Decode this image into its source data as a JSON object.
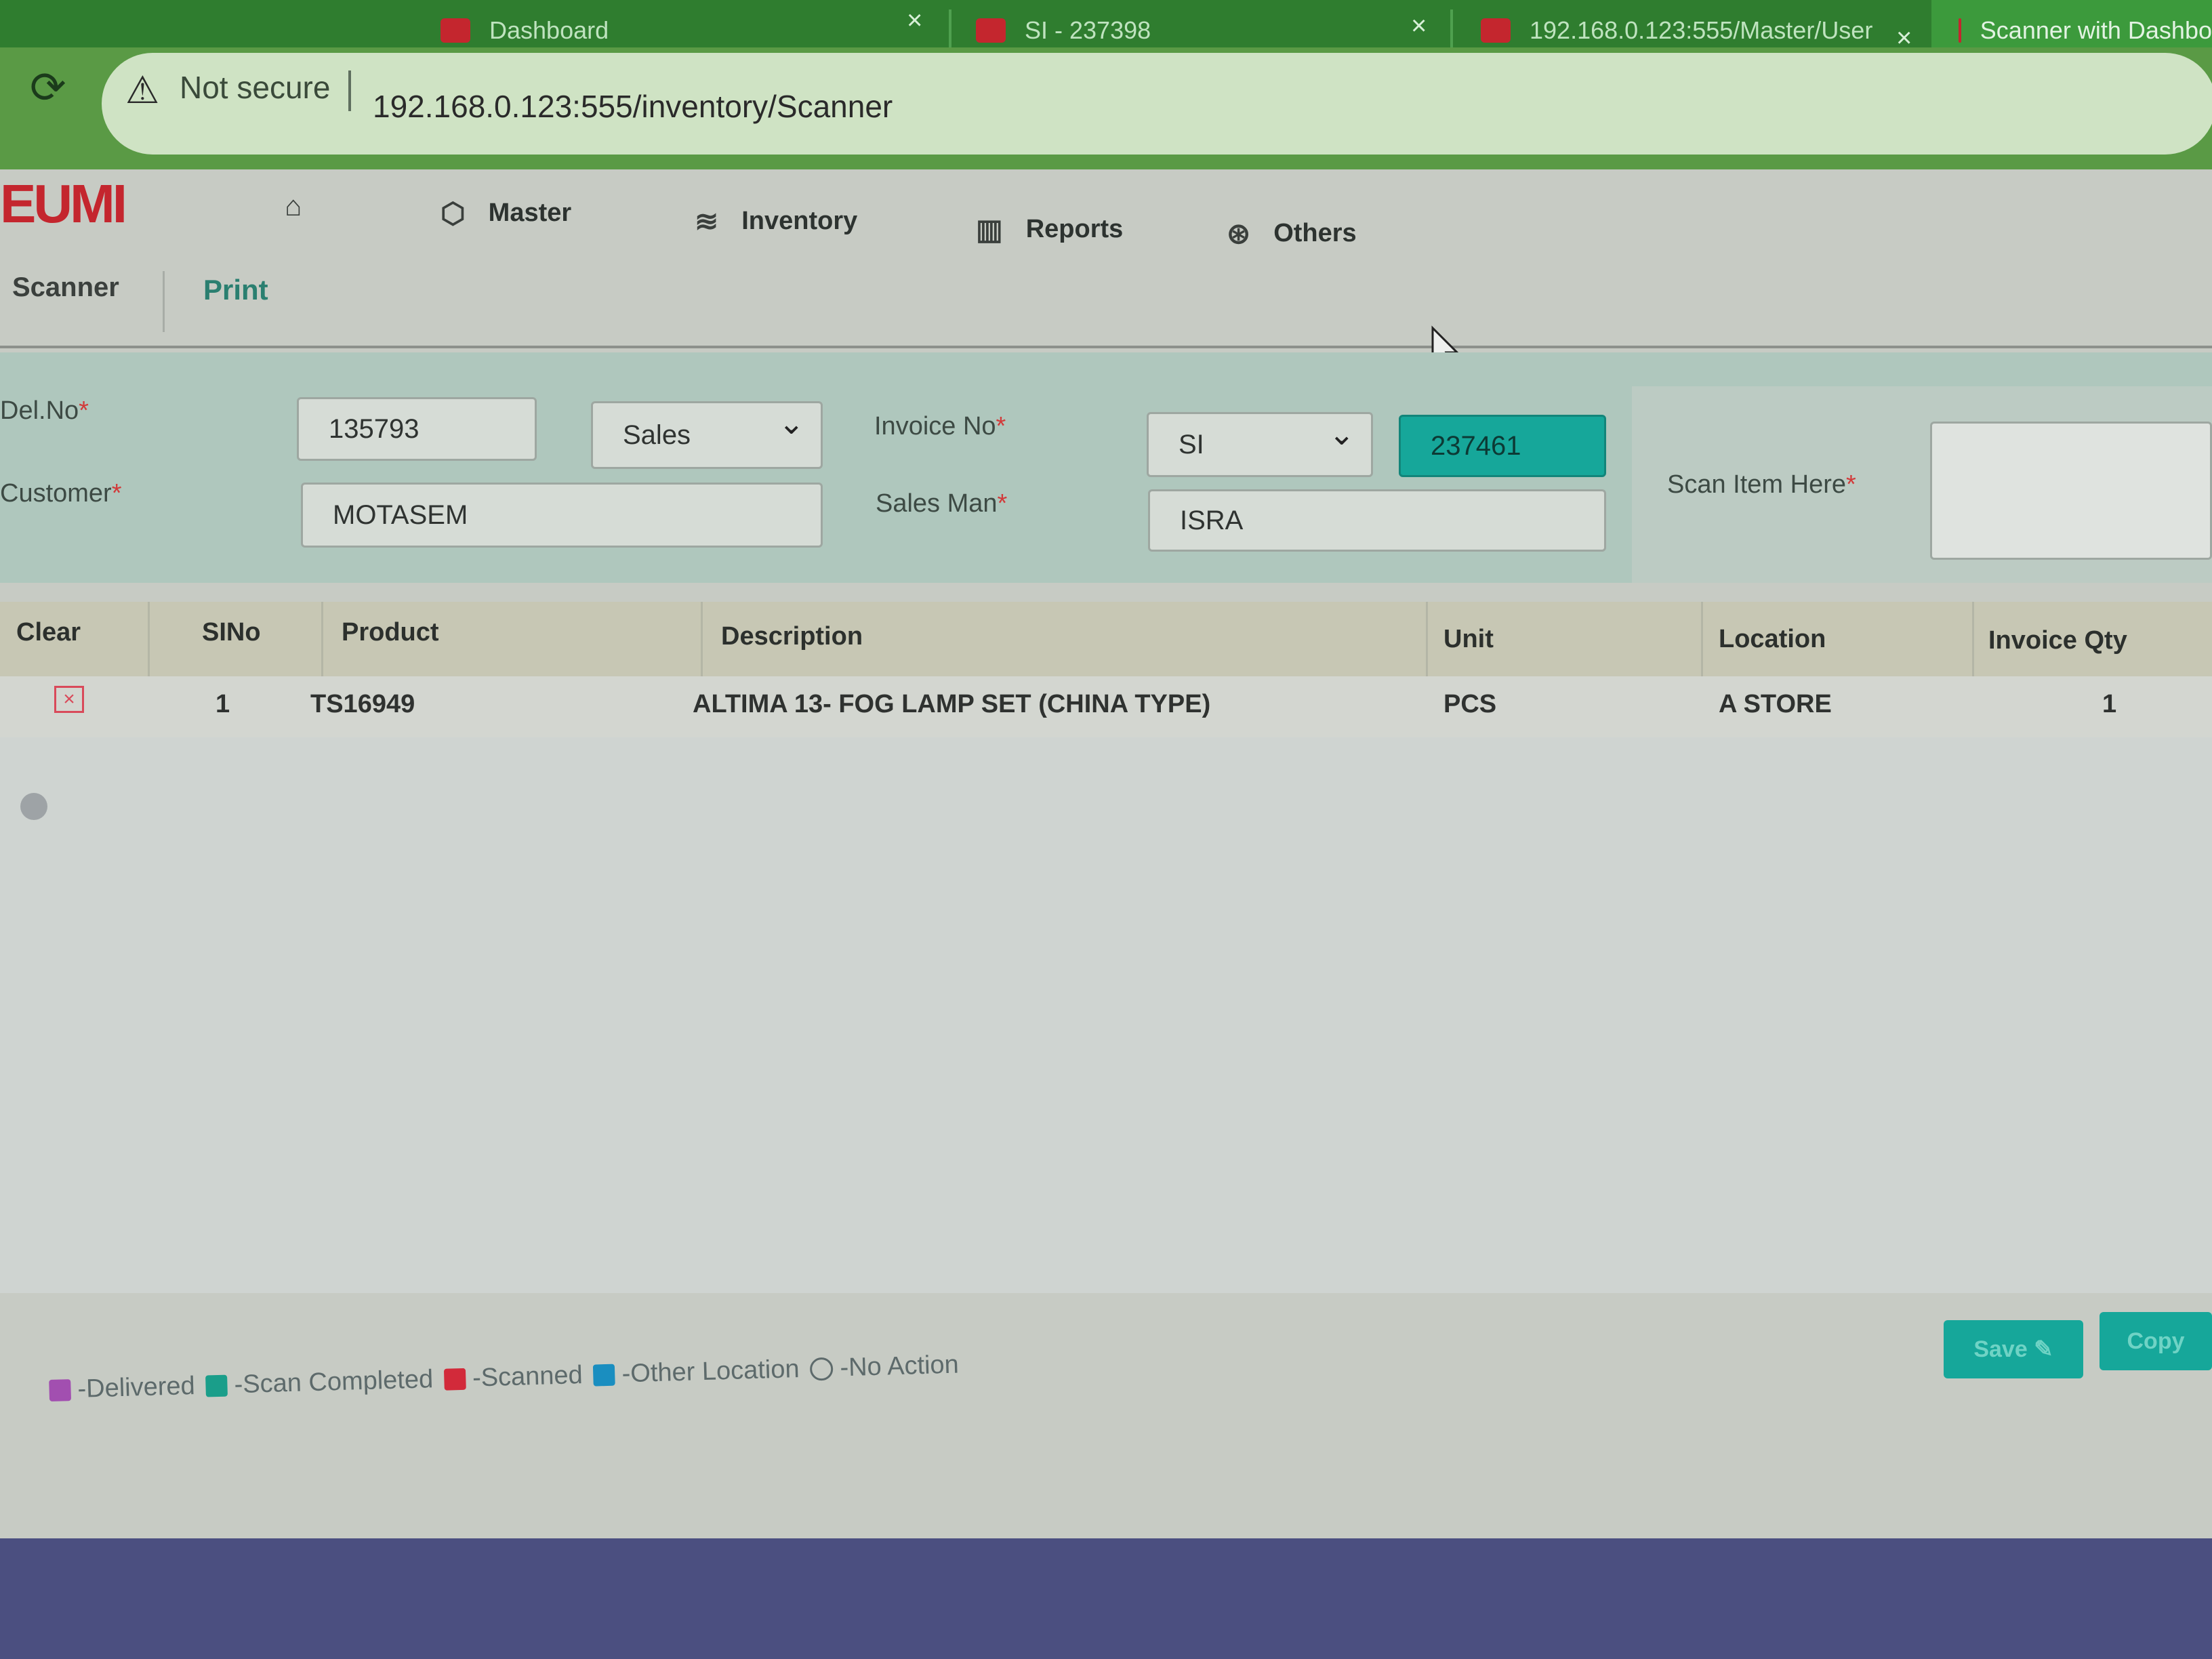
{
  "browser": {
    "tabs": [
      {
        "title": "Dashboard"
      },
      {
        "title": "SI - 237398"
      },
      {
        "title": "192.168.0.123:555/Master/User"
      },
      {
        "title": "Scanner with Dashbo"
      }
    ],
    "tab_close": "×",
    "security_label": "Not secure",
    "url": "192.168.0.123:555/inventory/Scanner"
  },
  "app": {
    "logo": "EUMI",
    "nav": [
      {
        "label": "",
        "icon": "home-icon"
      },
      {
        "label": "Master",
        "icon": "cube-icon"
      },
      {
        "label": "Inventory",
        "icon": "layers-icon"
      },
      {
        "label": "Reports",
        "icon": "bar-chart-icon"
      },
      {
        "label": "Others",
        "icon": "aperture-icon"
      }
    ],
    "subtabs": [
      "Scanner",
      "Print"
    ]
  },
  "form": {
    "del_no_label": "Del.No",
    "del_no_value": "135793",
    "type_value": "Sales",
    "customer_label": "Customer",
    "customer_value": "MOTASEM",
    "invoice_label": "Invoice No",
    "invoice_prefix": "SI",
    "invoice_number": "237461",
    "salesman_label": "Sales Man",
    "salesman_value": "ISRA",
    "scan_label": "Scan Item Here",
    "scan_value": "",
    "required_mark": "*"
  },
  "table": {
    "headers": [
      "Clear",
      "SINo",
      "Product",
      "Description",
      "Unit",
      "Location",
      "Invoice Qty"
    ],
    "rows": [
      {
        "sino": "1",
        "product": "TS16949",
        "description": "ALTIMA 13- FOG LAMP SET (CHINA TYPE)",
        "unit": "PCS",
        "location": "A STORE",
        "qty": "1"
      }
    ],
    "clear_glyph": "×"
  },
  "legend": [
    {
      "label": "-Delivered",
      "color": "#a24fb0"
    },
    {
      "label": "-Scan Completed",
      "color": "#1a9e8a"
    },
    {
      "label": "-Scanned",
      "color": "#d22a3a"
    },
    {
      "label": "-Other Location",
      "color": "#1a8ec0"
    },
    {
      "label": "-No Action",
      "color": "none"
    }
  ],
  "buttons": {
    "save": "Save ✎",
    "copy": "Copy"
  },
  "colors": {
    "accent": "#16a79a",
    "brand": "#c4262e",
    "browser_frame": "#2f7d2f"
  }
}
